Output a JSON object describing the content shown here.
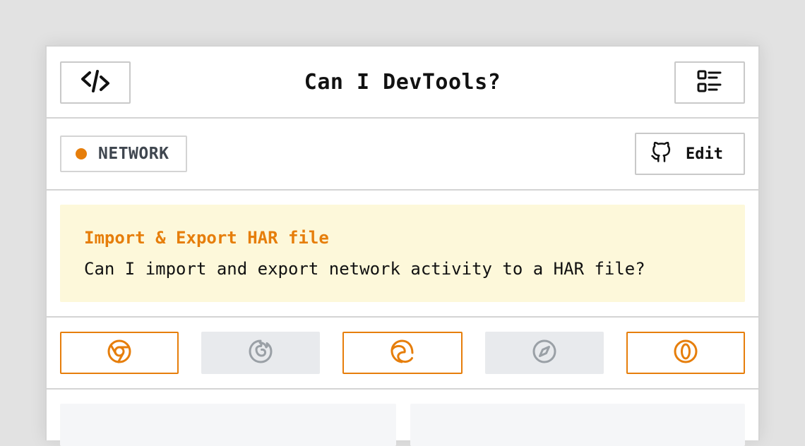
{
  "app": {
    "title": "Can I DevTools?"
  },
  "header": {
    "left_icon": "code-icon",
    "right_icon": "list-menu-icon"
  },
  "category": {
    "label": "NETWORK",
    "dot_color": "#e67e0b"
  },
  "edit": {
    "label": "Edit",
    "icon": "github-icon"
  },
  "feature": {
    "title": "Import & Export HAR file",
    "description": "Can I import and export network activity to a HAR file?",
    "background": "#fdf8da",
    "title_color": "#e67e0b"
  },
  "browsers": [
    {
      "name": "Chrome",
      "icon": "chrome-icon",
      "supported": true
    },
    {
      "name": "Firefox",
      "icon": "firefox-icon",
      "supported": false
    },
    {
      "name": "Edge",
      "icon": "edge-icon",
      "supported": true
    },
    {
      "name": "Safari",
      "icon": "safari-icon",
      "supported": false
    },
    {
      "name": "Opera",
      "icon": "opera-icon",
      "supported": true
    }
  ],
  "colors": {
    "accent": "#e67e0b",
    "unsupported_bg": "#e8eaed",
    "unsupported_icon": "#9aa0a6"
  }
}
